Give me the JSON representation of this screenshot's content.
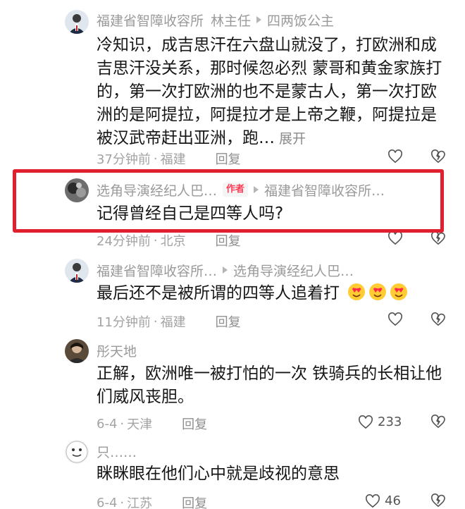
{
  "comments": [
    {
      "user": "福建省智障收容所",
      "role_tag": "林主任",
      "reply_to": "四两饭公主",
      "text": "冷知识，成吉思汗在六盘山就没了，打欧洲和成吉思汗没关系，那时候忽必烈 蒙哥和黄金家族打的，第一次打欧洲的也不是蒙古人，第一次打欧洲的是阿提拉，阿提拉才是上帝之鞭，阿提拉是被汉武帝赶出亚洲，跑…",
      "more_label": "展开",
      "time": "37分钟前",
      "location": "福建",
      "reply_label": "回复"
    },
    {
      "user": "选角导演经纪人巴…",
      "author_badge": "作者",
      "reply_to": "福建省智障收容所…",
      "text": "记得曾经自己是四等人吗?",
      "time": "24分钟前",
      "location": "北京",
      "reply_label": "回复"
    },
    {
      "user": "福建省智障收容所…",
      "reply_to": "选角导演经纪人巴…",
      "text": "最后还不是被所谓的四等人追着打",
      "emoji": "heart-eyes-emoji",
      "time": "11分钟前",
      "location": "福建",
      "reply_label": "回复"
    },
    {
      "user": "彤天地",
      "text": "正解，欧洲唯一被打怕的一次 铁骑兵的长相让他们威风丧胆。",
      "time": "6-4",
      "location": "天津",
      "reply_label": "回复",
      "likes": "233"
    },
    {
      "user": "只……",
      "text": "眯眯眼在他们心中就是歧视的意思",
      "time": "6-4",
      "location": "江苏",
      "reply_label": "回复",
      "likes": "46"
    }
  ],
  "meta_separator": "·",
  "icons": {
    "like": "heart-outline-icon",
    "dislike": "broken-heart-icon",
    "reply_arrow": "triangle-right-icon"
  },
  "colors": {
    "highlight": "#e0202e",
    "author_badge": "#ff3a55",
    "meta_text": "#a3a3a3"
  }
}
